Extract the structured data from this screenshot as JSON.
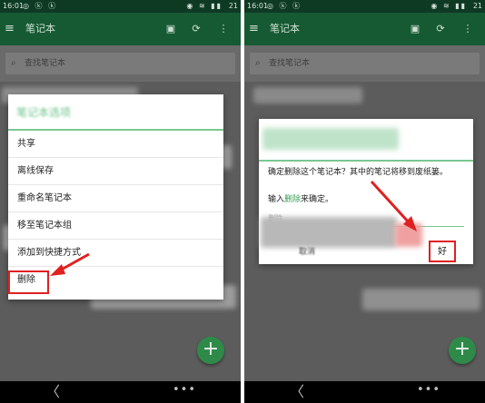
{
  "status_bar": {
    "time": "16:01",
    "left_icons": "◎ ⓚ ⓚ",
    "right_icons": "◉ ≋ ▮▮",
    "battery": "21"
  },
  "app": {
    "title": "笔记本",
    "menu_icon": "≡",
    "sync_icon": "⟳",
    "add_notebook_icon": "▣",
    "more_icon": "⋮"
  },
  "search": {
    "placeholder": "查找笔记本",
    "icon": "⌕"
  },
  "context_menu": {
    "title": "笔记本选项",
    "items": [
      "共享",
      "离线保存",
      "重命名笔记本",
      "移至笔记本组",
      "添加到快捷方式",
      "删除"
    ],
    "highlighted_item": "删除"
  },
  "confirm_dialog": {
    "message": "确定删除这个笔记本？其中的笔记将移到废纸篓。",
    "prompt_before": "输入",
    "prompt_keyword": "删除",
    "prompt_after": "来确定。",
    "input_value": "删除",
    "cancel_label": "取消",
    "ok_label": "好"
  },
  "fab": {
    "label": "+"
  },
  "nav": {
    "back_icon": "〈",
    "more_icon": "•••"
  },
  "colors": {
    "accent": "#165a33",
    "status_bar": "#0e3a23",
    "highlight": "#e02020",
    "fab": "#2f8a4a"
  }
}
